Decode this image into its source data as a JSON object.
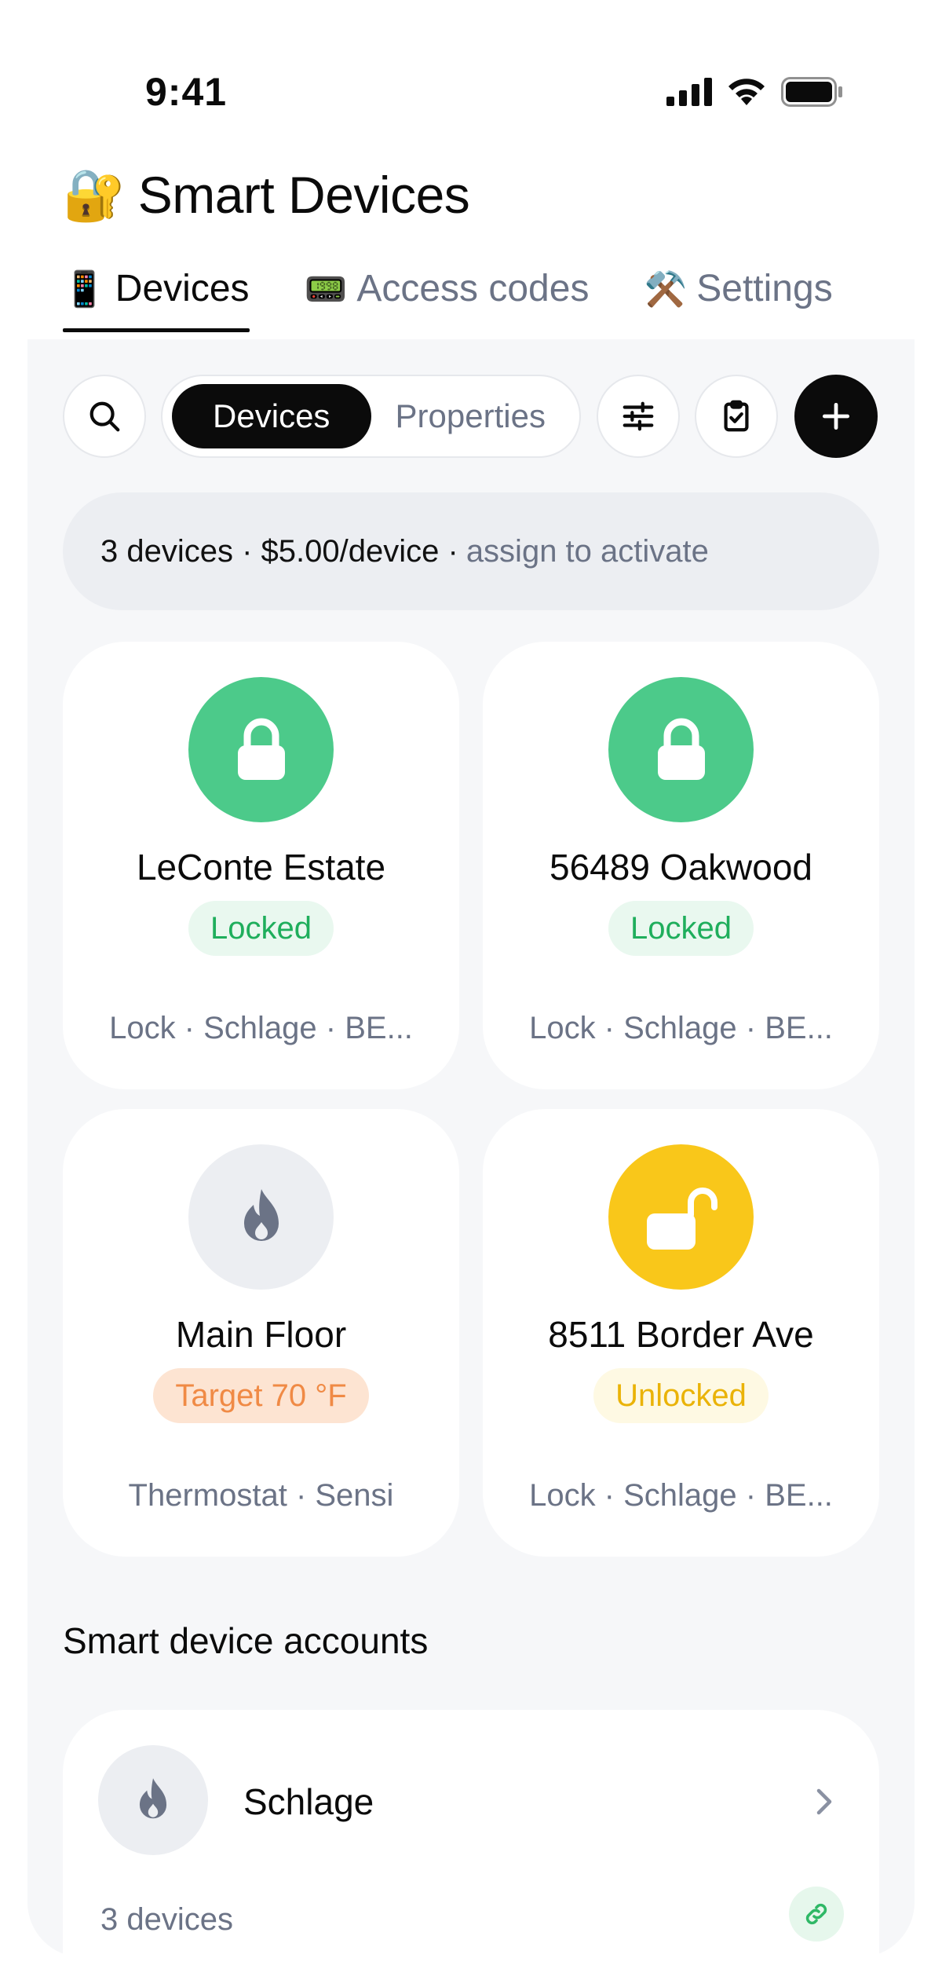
{
  "status_bar": {
    "time": "9:41"
  },
  "header": {
    "emoji": "🔐",
    "title": "Smart Devices"
  },
  "tabs": [
    {
      "emoji": "📱",
      "label": "Devices",
      "active": true
    },
    {
      "emoji": "📟",
      "label": "Access codes",
      "active": false
    },
    {
      "emoji": "⚒️",
      "label": "Settings",
      "active": false
    }
  ],
  "toolbar": {
    "segments": [
      {
        "label": "Devices",
        "active": true
      },
      {
        "label": "Properties",
        "active": false
      }
    ],
    "icons": [
      "search-icon",
      "filter-sliders-icon",
      "clipboard-check-icon",
      "plus-icon"
    ]
  },
  "info_banner": {
    "main": "3 devices · $5.00/device ·",
    "hint": "assign to activate"
  },
  "devices": [
    {
      "name": "LeConte Estate",
      "status": "Locked",
      "meta": "Lock · Schlage · BE...",
      "icon": "lock-icon",
      "state": "locked"
    },
    {
      "name": "56489 Oakwood",
      "status": "Locked",
      "meta": "Lock · Schlage · BE...",
      "icon": "lock-icon",
      "state": "locked"
    },
    {
      "name": "Main Floor",
      "status": "Target 70 °F",
      "meta": "Thermostat · Sensi",
      "icon": "flame-icon",
      "state": "thermostat"
    },
    {
      "name": "8511 Border Ave",
      "status": "Unlocked",
      "meta": "Lock · Schlage · BE...",
      "icon": "unlock-icon",
      "state": "unlocked"
    }
  ],
  "accounts_section": {
    "title": "Smart device accounts"
  },
  "accounts": [
    {
      "name": "Schlage",
      "count": "3 devices",
      "icon": "flame-icon"
    }
  ],
  "colors": {
    "locked_green": "#4cca8a",
    "locked_badge_bg": "#e9f8ef",
    "locked_badge_text": "#1fae5c",
    "unlocked_yellow": "#f9c71a",
    "unlocked_badge_bg": "#fef9e3",
    "unlocked_badge_text": "#eab308",
    "thermo_badge_bg": "#fde4d2",
    "thermo_badge_text": "#f08a45",
    "muted_text": "#6b7386",
    "panel_bg": "#f6f7f9"
  }
}
